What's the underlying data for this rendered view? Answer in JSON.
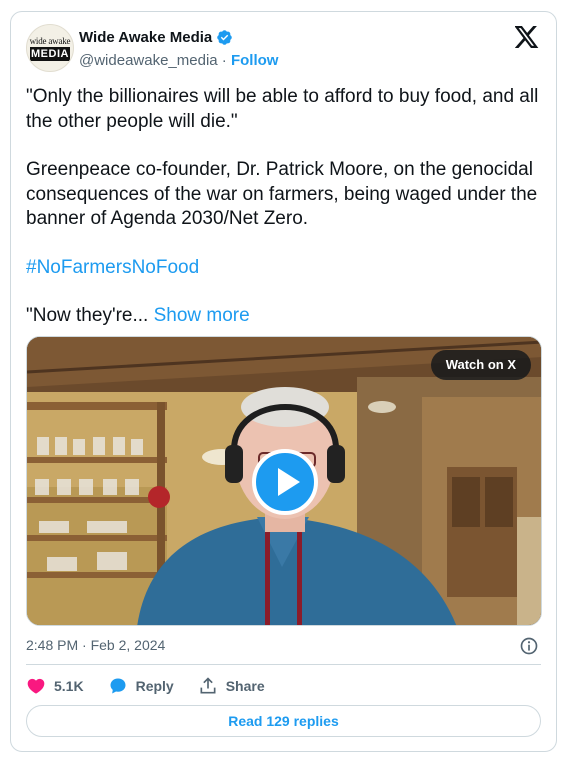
{
  "account": {
    "name": "Wide Awake Media",
    "handle": "@wideawake_media",
    "separator": " · ",
    "follow_label": "Follow",
    "avatar_text_top": "wide awake",
    "avatar_text_bottom": "MEDIA",
    "verified_color": "#1d9bf0"
  },
  "tweet": {
    "quote": "\"Only the billionaires will be able to afford to buy food, and all the other people will die.\"",
    "body": "Greenpeace co-founder, Dr. Patrick Moore, on the genocidal consequences of the war on farmers, being waged under the banner of Agenda 2030/Net Zero.",
    "hashtag": "#NoFarmersNoFood",
    "truncated": "\"Now they're... ",
    "show_more": "Show more"
  },
  "media": {
    "watch_label": "Watch on X",
    "play_icon": "play-icon"
  },
  "meta": {
    "timestamp": "2:48 PM · Feb 2, 2024"
  },
  "actions": {
    "likes": "5.1K",
    "reply_label": "Reply",
    "share_label": "Share",
    "read_replies": "Read 129 replies"
  },
  "colors": {
    "accent": "#1d9bf0",
    "like": "#f91880",
    "muted": "#536471",
    "border": "#cfd9de"
  }
}
